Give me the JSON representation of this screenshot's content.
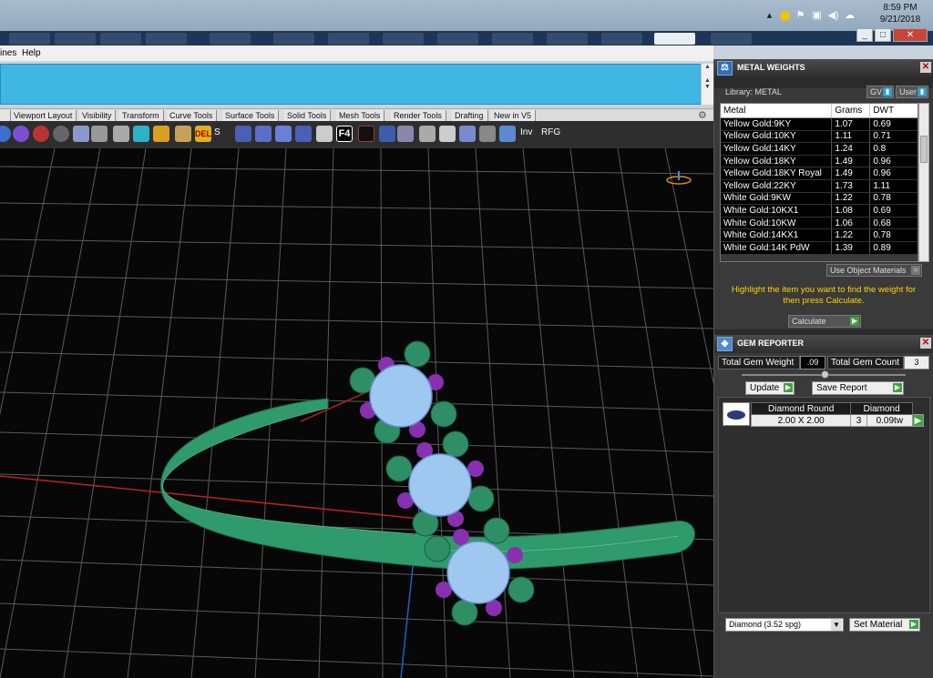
{
  "taskbar": {
    "time": "8:59 PM",
    "date": "9/21/2018",
    "tray_icons": [
      "chevron-up-icon",
      "norton-icon",
      "flag-icon",
      "network-icon",
      "volume-icon",
      "cloud-icon"
    ]
  },
  "window_controls": [
    "_",
    "□",
    "✕"
  ],
  "menubar": {
    "items": [
      "ines",
      "Help"
    ]
  },
  "toolbar_tabs": [
    "Viewport Layout",
    "Visibility",
    "Transform",
    "Curve Tools",
    "Surface Tools",
    "Solid Tools",
    "Mesh Tools",
    "Render Tools",
    "Drafting",
    "New in V5"
  ],
  "toolbar_text": {
    "s_label": "S",
    "f4_label": "F4",
    "inv_label": "Inv",
    "rfg_label": "RFG",
    "del_label": "DEL"
  },
  "metal_weights": {
    "title": "METAL WEIGHTS",
    "library_label": "Library: METAL",
    "gv_label": "GV",
    "user_label": "User",
    "columns": [
      "Metal",
      "Grams",
      "DWT"
    ],
    "rows": [
      [
        "Yellow Gold:9KY",
        "1.07",
        "0.69"
      ],
      [
        "Yellow Gold:10KY",
        "1.11",
        "0.71"
      ],
      [
        "Yellow Gold:14KY",
        "1.24",
        "0.8"
      ],
      [
        "Yellow Gold:18KY",
        "1.49",
        "0.96"
      ],
      [
        "Yellow Gold:18KY Royal",
        "1.49",
        "0.96"
      ],
      [
        "Yellow Gold:22KY",
        "1.73",
        "1.11"
      ],
      [
        "White Gold:9KW",
        "1.22",
        "0.78"
      ],
      [
        "White Gold:10KX1",
        "1.08",
        "0.69"
      ],
      [
        "White Gold:10KW",
        "1.06",
        "0.68"
      ],
      [
        "White Gold:14KX1",
        "1.22",
        "0.78"
      ],
      [
        "White Gold:14K PdW",
        "1.39",
        "0.89"
      ]
    ],
    "use_object_materials": "Use Object Materials",
    "instruction": "Highlight the item you want to find the weight for then press Calculate.",
    "calculate_label": "Calculate"
  },
  "gem_reporter": {
    "title": "GEM REPORTER",
    "total_weight_label": "Total Gem Weight",
    "total_weight_value": ".09",
    "total_count_label": "Total Gem Count",
    "total_count_value": "3",
    "update_label": "Update",
    "save_report_label": "Save Report",
    "gem_rows": [
      {
        "name": "Diamond Round",
        "material": "Diamond",
        "size": "2.00 X 2.00",
        "count": "3",
        "weight": "0.09tw"
      }
    ],
    "material_select": "Diamond     (3.52 spg)",
    "set_material_label": "Set Material"
  },
  "colors": {
    "ring": "#2f9a6b",
    "prongs_green": "#2e8f66",
    "prongs_purple": "#8a2fb0",
    "gem": "#9fc8f0",
    "command_area": "#3fb6e3",
    "instruction_text": "#ffd400"
  }
}
